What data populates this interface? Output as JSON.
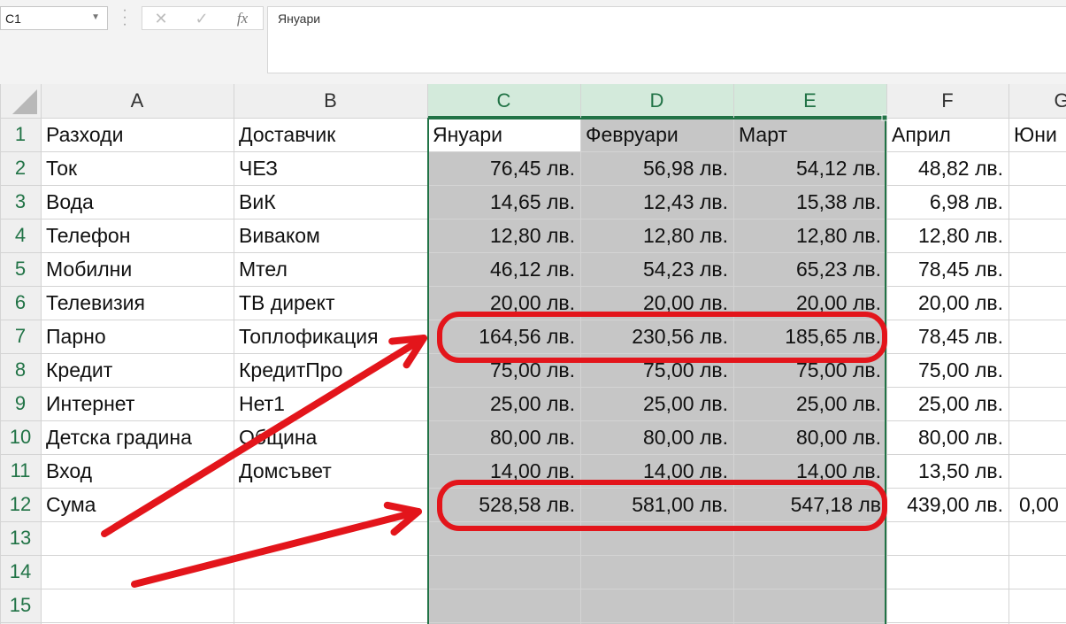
{
  "formula_bar": {
    "name_box": "C1",
    "cancel_icon": "✕",
    "enter_icon": "✓",
    "fx_icon": "fx",
    "formula_value": "Януари"
  },
  "colors": {
    "selection_fill": "#c6c6c6",
    "selection_border": "#217346",
    "selected_header_bg": "#d3eadb",
    "annotation_red": "#e3151b",
    "header_bg": "#efefef",
    "gridline": "#d4d4d4"
  },
  "columns": [
    "A",
    "B",
    "C",
    "D",
    "E",
    "F",
    "G"
  ],
  "selected_columns": [
    "C",
    "D",
    "E"
  ],
  "active_cell": "C1",
  "rows": [
    {
      "n": "1",
      "cells": [
        "Разходи",
        "Доставчик",
        "Януари",
        "Февруари",
        "Март",
        "Април",
        "Юни"
      ]
    },
    {
      "n": "2",
      "cells": [
        "Ток",
        "ЧЕЗ",
        "76,45 лв.",
        "56,98 лв.",
        "54,12 лв.",
        "48,82 лв.",
        ""
      ]
    },
    {
      "n": "3",
      "cells": [
        "Вода",
        "ВиК",
        "14,65 лв.",
        "12,43 лв.",
        "15,38 лв.",
        "6,98 лв.",
        ""
      ]
    },
    {
      "n": "4",
      "cells": [
        "Телефон",
        "Виваком",
        "12,80 лв.",
        "12,80 лв.",
        "12,80 лв.",
        "12,80 лв.",
        ""
      ]
    },
    {
      "n": "5",
      "cells": [
        "Мобилни",
        "Мтел",
        "46,12 лв.",
        "54,23 лв.",
        "65,23 лв.",
        "78,45 лв.",
        ""
      ]
    },
    {
      "n": "6",
      "cells": [
        "Телевизия",
        "ТВ директ",
        "20,00 лв.",
        "20,00 лв.",
        "20,00 лв.",
        "20,00 лв.",
        ""
      ]
    },
    {
      "n": "7",
      "cells": [
        "Парно",
        "Топлофикация",
        "164,56 лв.",
        "230,56 лв.",
        "185,65 лв.",
        "78,45 лв.",
        ""
      ]
    },
    {
      "n": "8",
      "cells": [
        "Кредит",
        "КредитПро",
        "75,00 лв.",
        "75,00 лв.",
        "75,00 лв.",
        "75,00 лв.",
        ""
      ]
    },
    {
      "n": "9",
      "cells": [
        "Интернет",
        "Нет1",
        "25,00 лв.",
        "25,00 лв.",
        "25,00 лв.",
        "25,00 лв.",
        ""
      ]
    },
    {
      "n": "10",
      "cells": [
        "Детска градина",
        "Община",
        "80,00 лв.",
        "80,00 лв.",
        "80,00 лв.",
        "80,00 лв.",
        ""
      ]
    },
    {
      "n": "11",
      "cells": [
        "Вход",
        "Домсъвет",
        "14,00 лв.",
        "14,00 лв.",
        "14,00 лв.",
        "13,50 лв.",
        ""
      ]
    },
    {
      "n": "12",
      "cells": [
        "Сума",
        "",
        "528,58 лв.",
        "581,00 лв.",
        "547,18 лв",
        "439,00 лв.",
        "0,00"
      ]
    },
    {
      "n": "13",
      "cells": [
        "",
        "",
        "",
        "",
        "",
        "",
        ""
      ]
    },
    {
      "n": "14",
      "cells": [
        "",
        "",
        "",
        "",
        "",
        "",
        ""
      ]
    },
    {
      "n": "15",
      "cells": [
        "",
        "",
        "",
        "",
        "",
        "",
        ""
      ]
    }
  ],
  "highlighted_rows": [
    "7",
    "12"
  ]
}
